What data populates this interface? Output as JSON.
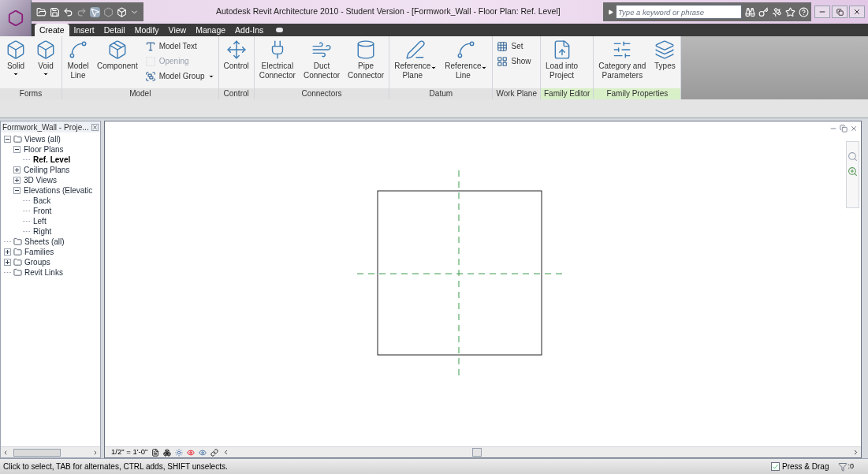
{
  "title_bar": {
    "title": "Autodesk Revit Architecture 2010 - Student Version - [Formwork_Wall - Floor Plan: Ref. Level]",
    "search": {
      "placeholder": "Type a keyword or phrase"
    }
  },
  "tabs": [
    {
      "label": "Create",
      "selected": true
    },
    {
      "label": "Insert",
      "selected": false
    },
    {
      "label": "Detail",
      "selected": false
    },
    {
      "label": "Modify",
      "selected": false
    },
    {
      "label": "View",
      "selected": false
    },
    {
      "label": "Manage",
      "selected": false
    },
    {
      "label": "Add-Ins",
      "selected": false
    }
  ],
  "ribbon": [
    {
      "title": "Forms",
      "highlighted": false,
      "tools": [
        {
          "kind": "large",
          "label": "Solid",
          "dropdown": true,
          "caret_beside": false
        },
        {
          "kind": "large",
          "label": "Void",
          "dropdown": true,
          "caret_beside": false
        }
      ]
    },
    {
      "title": "Model",
      "highlighted": false,
      "tools": [
        {
          "kind": "large",
          "label": "Model\nLine",
          "dropdown": false
        },
        {
          "kind": "large",
          "label": "Component",
          "dropdown": false
        },
        {
          "kind": "stack",
          "items": [
            {
              "label": "Model Text",
              "disabled": false,
              "dropdown": false
            },
            {
              "label": "Opening",
              "disabled": true,
              "dropdown": false
            },
            {
              "label": "Model Group",
              "disabled": false,
              "dropdown": true
            }
          ]
        }
      ]
    },
    {
      "title": "Control",
      "highlighted": false,
      "tools": [
        {
          "kind": "large",
          "label": "Control",
          "dropdown": false
        }
      ]
    },
    {
      "title": "Connectors",
      "highlighted": false,
      "tools": [
        {
          "kind": "large",
          "label": "Electrical\nConnector",
          "dropdown": false
        },
        {
          "kind": "large",
          "label": "Duct\nConnector",
          "dropdown": false
        },
        {
          "kind": "large",
          "label": "Pipe\nConnector",
          "dropdown": false
        }
      ]
    },
    {
      "title": "Datum",
      "highlighted": false,
      "tools": [
        {
          "kind": "large",
          "label": "Reference\nPlane",
          "dropdown": true,
          "caret_beside": true
        },
        {
          "kind": "large",
          "label": "Reference\nLine",
          "dropdown": true,
          "caret_beside": true
        }
      ]
    },
    {
      "title": "Work Plane",
      "highlighted": false,
      "tools": [
        {
          "kind": "stack",
          "items": [
            {
              "label": "Set",
              "disabled": false,
              "dropdown": false
            },
            {
              "label": "Show",
              "disabled": false,
              "dropdown": false
            }
          ]
        }
      ]
    },
    {
      "title": "Family Editor",
      "highlighted": true,
      "tools": [
        {
          "kind": "large",
          "label": "Load into\nProject",
          "dropdown": false
        }
      ]
    },
    {
      "title": "Family Properties",
      "highlighted": true,
      "tools": [
        {
          "kind": "large",
          "label": "Category and\nParameters",
          "dropdown": false
        },
        {
          "kind": "large",
          "label": "Types",
          "dropdown": false
        }
      ]
    }
  ],
  "project_browser": {
    "title": "Formwork_Wall - Proje...",
    "tree": [
      {
        "label": "Views (all)",
        "expanded": true,
        "selected": false,
        "children": [
          {
            "label": "Floor Plans",
            "expanded": true,
            "selected": false,
            "children": [
              {
                "label": "Ref. Level",
                "selected": true
              }
            ]
          },
          {
            "label": "Ceiling Plans",
            "expanded": false,
            "selected": false
          },
          {
            "label": "3D Views",
            "expanded": false,
            "selected": false
          },
          {
            "label": "Elevations (Elevatic",
            "expanded": true,
            "selected": false,
            "children": [
              {
                "label": "Back",
                "selected": false
              },
              {
                "label": "Front",
                "selected": false
              },
              {
                "label": "Left",
                "selected": false
              },
              {
                "label": "Right",
                "selected": false
              }
            ]
          }
        ]
      },
      {
        "label": "Sheets (all)",
        "selected": false
      },
      {
        "label": "Families",
        "expanded": false,
        "selected": false
      },
      {
        "label": "Groups",
        "expanded": false,
        "selected": false
      },
      {
        "label": "Revit Links",
        "selected": false
      }
    ]
  },
  "view_control_bar": {
    "scale": "1/2\" = 1'-0\""
  },
  "status_bar": {
    "message": "Click to select, TAB for alternates, CTRL adds, SHIFT unselects.",
    "press_drag": {
      "label": "Press & Drag",
      "checked": true
    },
    "filter_count": ":0"
  }
}
